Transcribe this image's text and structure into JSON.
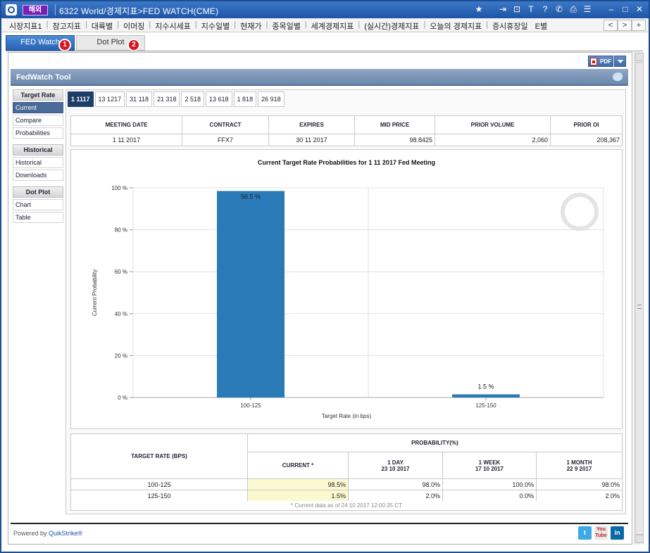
{
  "window": {
    "badge": "해외",
    "title": "6322 World/경제지표>FED WATCH(CME)"
  },
  "menu": [
    "시장지표1",
    "참고지표",
    "대륙별",
    "이머징",
    "지수시세표",
    "지수일별",
    "현재가",
    "종목일별",
    "세계경제지표",
    "(실시간)경제지표",
    "오늘의 경제지표",
    "증시휴장일",
    "E별"
  ],
  "menu_arrows": [
    "<",
    ">",
    "+"
  ],
  "subtabs": [
    {
      "label": "FED Watch",
      "badge": "1"
    },
    {
      "label": "Dot Plot",
      "badge": "2"
    }
  ],
  "toolbar": {
    "pdf_label": "PDF"
  },
  "fedwatch": {
    "title": "FedWatch Tool"
  },
  "leftnav": {
    "groups": [
      {
        "heading": "Target Rate",
        "items": [
          "Current",
          "Compare",
          "Probabilities"
        ]
      },
      {
        "heading": "Historical",
        "items": [
          "Historical",
          "Downloads"
        ]
      },
      {
        "heading": "Dot Plot",
        "items": [
          "Chart",
          "Table"
        ]
      }
    ]
  },
  "date_tabs": [
    "1 1117",
    "13 1217",
    "31 118",
    "21 318",
    "2 518",
    "13 618",
    "1 818",
    "26 918"
  ],
  "meeting_table": {
    "headers": [
      "MEETING DATE",
      "CONTRACT",
      "EXPIRES",
      "MID PRICE",
      "PRIOR VOLUME",
      "PRIOR OI"
    ],
    "row": [
      "1 11 2017",
      "FFX7",
      "30 11 2017",
      "98.8425",
      "2,060",
      "208,367"
    ]
  },
  "chart_data": {
    "type": "bar",
    "title": "Current Target Rate Probabilities for 1 11 2017 Fed Meeting",
    "xlabel": "Target Rate (in bps)",
    "ylabel": "Current Probability",
    "categories": [
      "100-125",
      "125-150"
    ],
    "values": [
      98.5,
      1.5
    ],
    "value_labels": [
      "98.5 %",
      "1.5 %"
    ],
    "ylim": [
      0,
      100
    ],
    "yticks": [
      0,
      20,
      40,
      60,
      80,
      100
    ],
    "ytick_labels": [
      "0 %",
      "20 %",
      "40 %",
      "60 %",
      "80 %",
      "100 %"
    ],
    "grid": true,
    "bar_color": "#2a7ab8"
  },
  "prob_table": {
    "target_header": "TARGET RATE (BPS)",
    "group_header": "PROBABILITY(%)",
    "col_headers": [
      {
        "line1": "CURRENT *",
        "line2": ""
      },
      {
        "line1": "1 DAY",
        "line2": "23 10 2017"
      },
      {
        "line1": "1 WEEK",
        "line2": "17 10 2017"
      },
      {
        "line1": "1 MONTH",
        "line2": "22 9 2017"
      }
    ],
    "rows": [
      {
        "rate": "100-125",
        "values": [
          "98.5%",
          "98.0%",
          "100.0%",
          "98.0%"
        ]
      },
      {
        "rate": "125-150",
        "values": [
          "1.5%",
          "2.0%",
          "0.0%",
          "2.0%"
        ]
      }
    ],
    "footnote": "* Current data as of 24 10 2017 12:00:35 CT"
  },
  "footer": {
    "powered_prefix": "Powered by ",
    "powered_brand": "QuikStrike®",
    "social": [
      "t",
      "You Tube",
      "in"
    ]
  }
}
